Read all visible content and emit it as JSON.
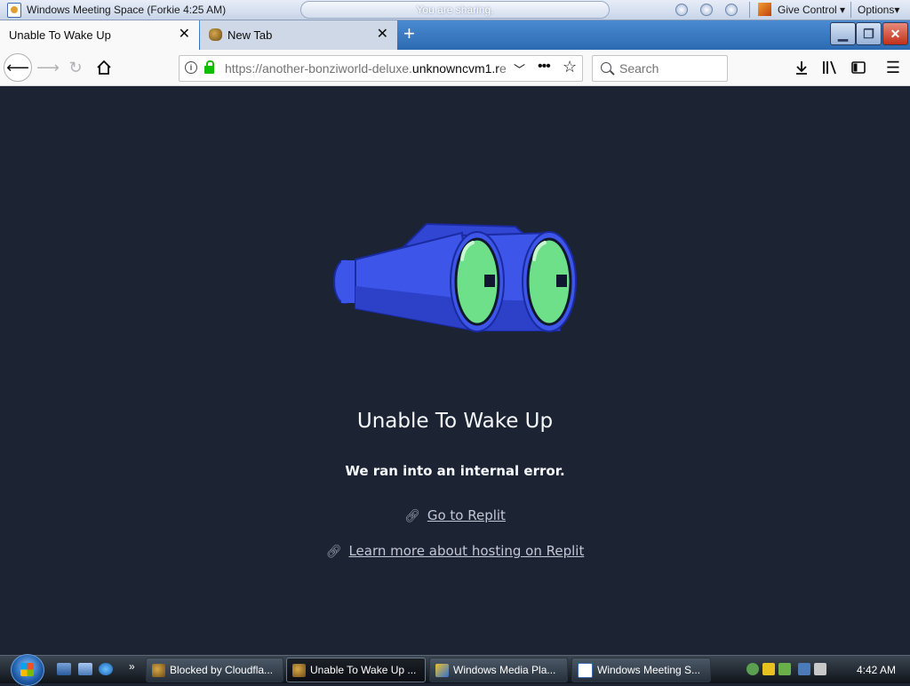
{
  "meeting_bar": {
    "title": "Windows Meeting Space (Forkie 4:25 AM)",
    "status": "You are sharing.",
    "give_control": "Give Control ▾",
    "options": "Options▾"
  },
  "tabs": [
    {
      "label": "Unable To Wake Up",
      "active": true
    },
    {
      "label": "New Tab",
      "active": false
    }
  ],
  "nav": {
    "url_prefix": "https://another-bonziworl",
    "url_host_start": "d-deluxe.",
    "url_host": "unknowncvm1.r",
    "url_tail": "e",
    "search_placeholder": "Search"
  },
  "page": {
    "title": "Unable To Wake Up",
    "description": "We ran into an internal error.",
    "link_replit": "Go to Replit",
    "link_hosting": "Learn more about hosting on Replit",
    "colors": {
      "background": "#1c2333",
      "binocular_body": "#3d55e8",
      "lens": "#6fe08a"
    }
  },
  "taskbar": {
    "buttons": [
      {
        "label": "Blocked by Cloudfla...",
        "icon": "bonzi-icon",
        "active": false
      },
      {
        "label": "Unable To Wake Up ...",
        "icon": "bonzi-icon",
        "active": true
      },
      {
        "label": "Windows Media Pla...",
        "icon": "media-player-icon",
        "active": false
      },
      {
        "label": "Windows Meeting S...",
        "icon": "meeting-space-icon",
        "active": false
      }
    ],
    "clock": "4:42 AM"
  }
}
